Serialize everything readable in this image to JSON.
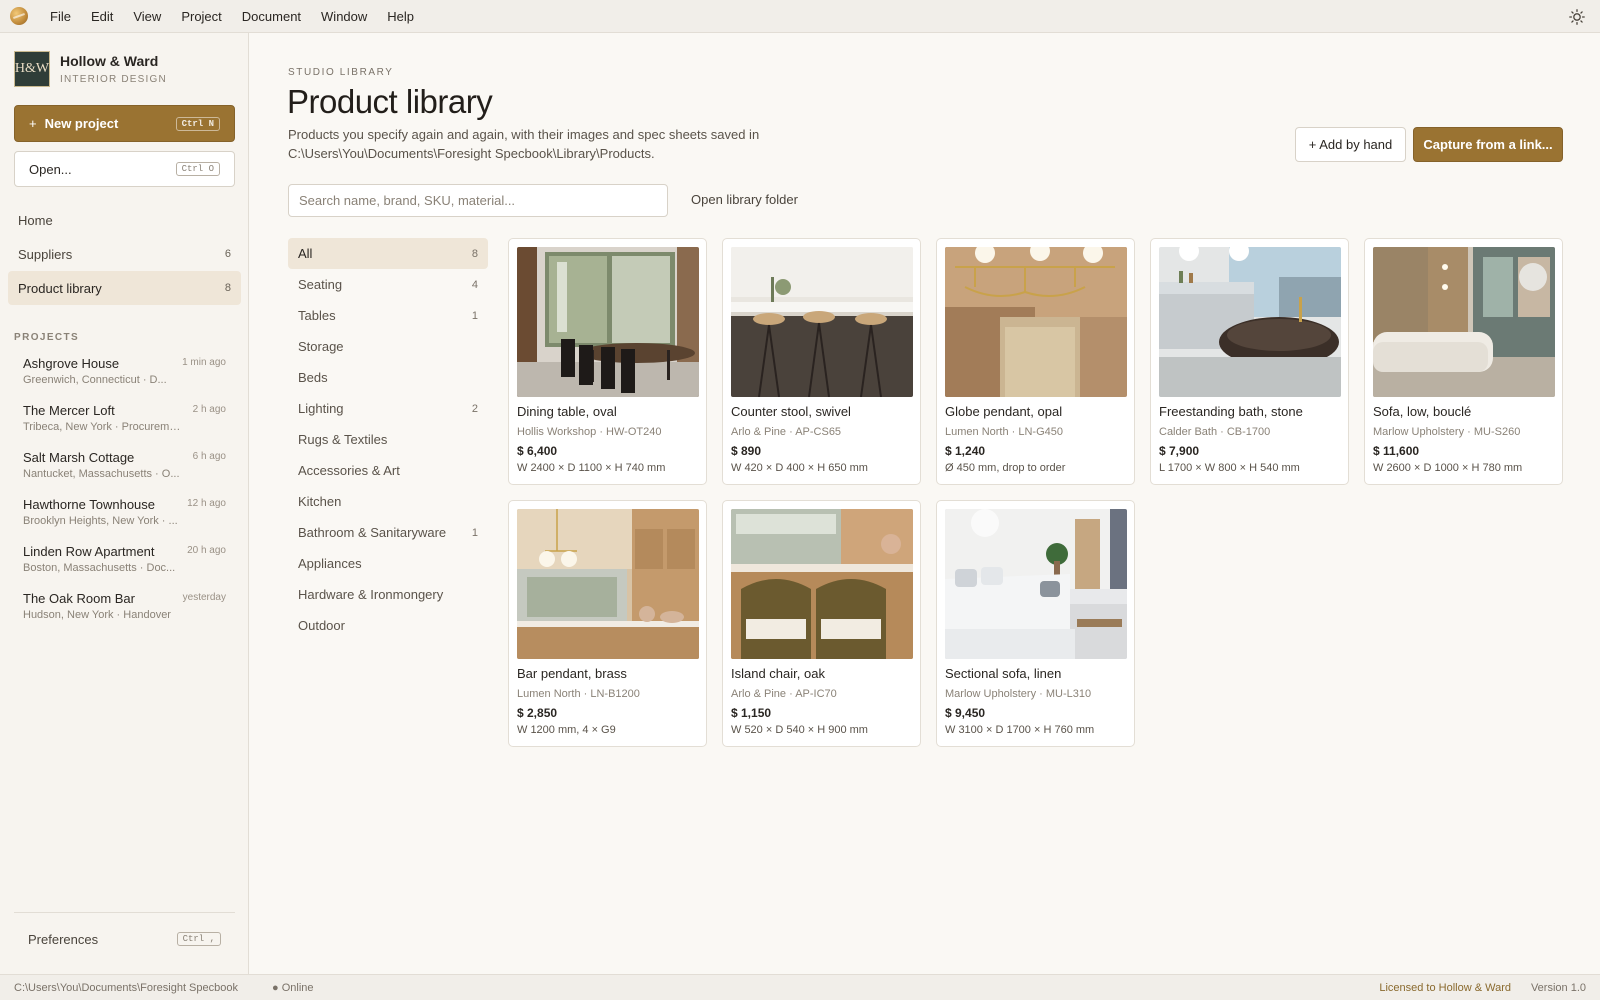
{
  "menu": [
    "File",
    "Edit",
    "View",
    "Project",
    "Document",
    "Window",
    "Help"
  ],
  "brand": {
    "mark": "H&W",
    "name": "Hollow & Ward",
    "sub": "INTERIOR DESIGN"
  },
  "actions": {
    "new_project": "New project",
    "new_project_plus": "+",
    "new_project_kbd": "Ctrl N",
    "open": "Open...",
    "open_kbd": "Ctrl O"
  },
  "nav": [
    {
      "label": "Home",
      "count": ""
    },
    {
      "label": "Suppliers",
      "count": "6"
    },
    {
      "label": "Product library",
      "count": "8"
    }
  ],
  "projects_heading": "PROJECTS",
  "projects": [
    {
      "name": "Ashgrove House",
      "time": "1 min ago",
      "location": "Greenwich, Connecticut · D..."
    },
    {
      "name": "The Mercer Loft",
      "time": "2 h ago",
      "location": "Tribeca, New York · Procureme..."
    },
    {
      "name": "Salt Marsh Cottage",
      "time": "6 h ago",
      "location": "Nantucket, Massachusetts · O..."
    },
    {
      "name": "Hawthorne Townhouse",
      "time": "12 h ago",
      "location": "Brooklyn Heights, New York · ..."
    },
    {
      "name": "Linden Row Apartment",
      "time": "20 h ago",
      "location": "Boston, Massachusetts · Doc..."
    },
    {
      "name": "The Oak Room Bar",
      "time": "yesterday",
      "location": "Hudson, New York · Handover"
    }
  ],
  "preferences": {
    "label": "Preferences",
    "kbd": "Ctrl ,"
  },
  "page": {
    "eyebrow": "STUDIO LIBRARY",
    "title": "Product library",
    "subtitle": "Products you specify again and again, with their images and spec sheets saved in C:\\Users\\You\\Documents\\Foresight Specbook\\Library\\Products.",
    "add_by_hand": "+ Add by hand",
    "capture": "Capture from a link...",
    "search_placeholder": "Search name, brand, SKU, material...",
    "open_folder": "Open library folder"
  },
  "categories": [
    {
      "label": "All",
      "count": "8"
    },
    {
      "label": "Seating",
      "count": "4"
    },
    {
      "label": "Tables",
      "count": "1"
    },
    {
      "label": "Storage",
      "count": ""
    },
    {
      "label": "Beds",
      "count": ""
    },
    {
      "label": "Lighting",
      "count": "2"
    },
    {
      "label": "Rugs & Textiles",
      "count": ""
    },
    {
      "label": "Accessories & Art",
      "count": ""
    },
    {
      "label": "Kitchen",
      "count": ""
    },
    {
      "label": "Bathroom & Sanitaryware",
      "count": "1"
    },
    {
      "label": "Appliances",
      "count": ""
    },
    {
      "label": "Hardware & Ironmongery",
      "count": ""
    },
    {
      "label": "Outdoor",
      "count": ""
    }
  ],
  "products": [
    {
      "name": "Dining table, oval",
      "meta": "Hollis Workshop · HW-OT240",
      "price": "$ 6,400",
      "dims": "W 2400 × D 1100 × H 740 mm",
      "image": "dining-room-photo"
    },
    {
      "name": "Counter stool, swivel",
      "meta": "Arlo & Pine · AP-CS65",
      "price": "$ 890",
      "dims": "W 420 × D 400 × H 650 mm",
      "image": "kitchen-stools-photo"
    },
    {
      "name": "Globe pendant, opal",
      "meta": "Lumen North · LN-G450",
      "price": "$ 1,240",
      "dims": "Ø 450 mm, drop to order",
      "image": "brass-chandelier-photo"
    },
    {
      "name": "Freestanding bath, stone",
      "meta": "Calder Bath · CB-1700",
      "price": "$ 7,900",
      "dims": "L 1700 × W 800 × H 540 mm",
      "image": "bathroom-photo"
    },
    {
      "name": "Sofa, low, bouclé",
      "meta": "Marlow Upholstery · MU-S260",
      "price": "$ 11,600",
      "dims": "W 2600 × D 1000 × H 780 mm",
      "image": "sofa-room-photo"
    },
    {
      "name": "Bar pendant, brass",
      "meta": "Lumen North · LN-B1200",
      "price": "$ 2,850",
      "dims": "W 1200 mm, 4 × G9",
      "image": "kitchen-pendant-photo"
    },
    {
      "name": "Island chair, oak",
      "meta": "Arlo & Pine · AP-IC70",
      "price": "$ 1,150",
      "dims": "W 520 × D 540 × H 900 mm",
      "image": "island-chairs-photo"
    },
    {
      "name": "Sectional sofa, linen",
      "meta": "Marlow Upholstery · MU-L310",
      "price": "$ 9,450",
      "dims": "W 3100 × D 1700 × H 760 mm",
      "image": "living-room-photo"
    }
  ],
  "status": {
    "path": "C:\\Users\\You\\Documents\\Foresight Specbook",
    "online": "● Online",
    "license": "Licensed to Hollow & Ward",
    "version": "Version 1.0"
  },
  "colors": {
    "accent": "#9a7332",
    "active_bg": "#efe6d8",
    "background": "#faf8f4"
  }
}
